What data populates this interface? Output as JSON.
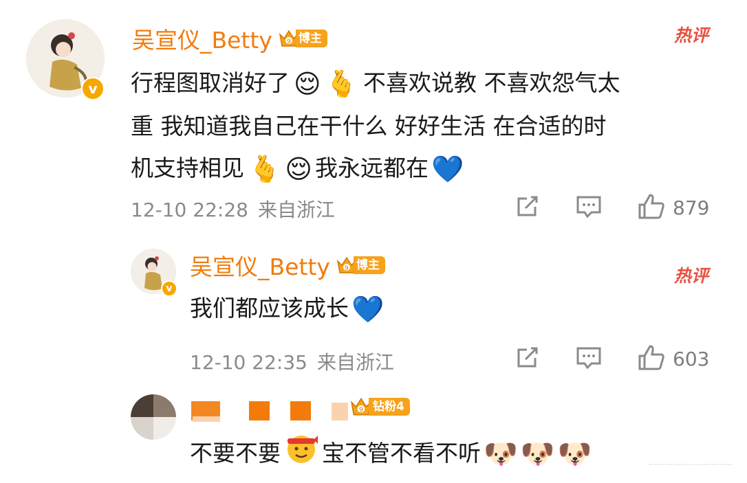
{
  "comments": [
    {
      "username": "吴宣仪_Betty",
      "badge_label": "博主",
      "crown_level": "9",
      "hot_label": "热评",
      "text_lines": [
        [
          "行程图取消好了",
          "😌",
          "🫰",
          "不喜欢说教 不喜欢怨气太"
        ],
        [
          "重 我知道我自己在干什么 好好生活 在合适的时"
        ],
        [
          "机支持相见",
          "🫰",
          "😌",
          "我永远都在",
          "💙"
        ]
      ],
      "date": "12-10 22:28",
      "location": "来自浙江",
      "likes": "879"
    },
    {
      "username": "吴宣仪_Betty",
      "badge_label": "博主",
      "crown_level": "9",
      "hot_label": "热评",
      "text": "我们都应该成长",
      "emoji": "💙",
      "date": "12-10 22:35",
      "location": "来自浙江",
      "likes": "603"
    },
    {
      "badge_label": "钻粉4",
      "crown_level": "9",
      "text_a": "不要不要",
      "text_b": "宝不管不看不听",
      "emojis": [
        "🐶",
        "🐶",
        "🐶"
      ]
    }
  ],
  "icons": {
    "share": "share-icon",
    "comment": "comment-icon",
    "like": "thumbs-up-icon",
    "verified": "v"
  },
  "colors": {
    "username": "#f27b0b",
    "hot": "#e8503f",
    "meta": "#8a8a8a",
    "badge": "#f6a21b"
  }
}
